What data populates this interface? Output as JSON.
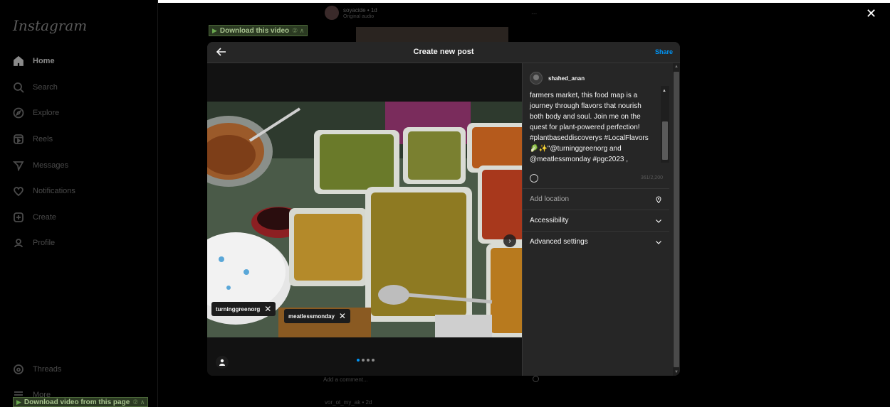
{
  "background": {
    "logo": "Instagram",
    "nav": [
      {
        "label": "Home",
        "icon": "home-icon",
        "active": true
      },
      {
        "label": "Search",
        "icon": "search-icon"
      },
      {
        "label": "Explore",
        "icon": "compass-icon"
      },
      {
        "label": "Reels",
        "icon": "reels-icon"
      },
      {
        "label": "Messages",
        "icon": "send-icon"
      },
      {
        "label": "Notifications",
        "icon": "heart-icon"
      },
      {
        "label": "Create",
        "icon": "plus-square-icon"
      },
      {
        "label": "Profile",
        "icon": "profile-avatar-icon"
      }
    ],
    "nav_bottom": [
      {
        "label": "Threads",
        "icon": "threads-icon"
      },
      {
        "label": "More",
        "icon": "menu-icon"
      }
    ],
    "feed": {
      "username": "soyacide",
      "time": "• 1d",
      "audio": "Original audio",
      "more": "...",
      "comment_placeholder": "Add a comment...",
      "next_user": "vor_ot_my_ak • 2d"
    },
    "download_top": {
      "label": "Download this video",
      "extra": "② ∧"
    },
    "download_bottom": {
      "label": "Download video from this page",
      "extra": "② ∧"
    }
  },
  "modal": {
    "title": "Create new post",
    "share_label": "Share",
    "tags": [
      "turninggreenorg",
      "meatlessmonday"
    ],
    "carousel": {
      "count": 4,
      "active": 0
    },
    "username": "shahed_anan",
    "caption": "farmers market, this food map is a journey through flavors that nourish both body and soul. Join me on the quest for plant-powered perfection! #plantbaseddiscoverys #LocalFlavors 🥬✨\"@turninggreenorg and @meatlessmonday #pgc2023 ,",
    "char_count": "361/2,200",
    "add_location": "Add location",
    "accessibility": "Accessibility",
    "advanced_settings": "Advanced settings"
  },
  "colors": {
    "accent": "#0095f6",
    "modal_bg": "#262626",
    "overlay": "#000000"
  }
}
